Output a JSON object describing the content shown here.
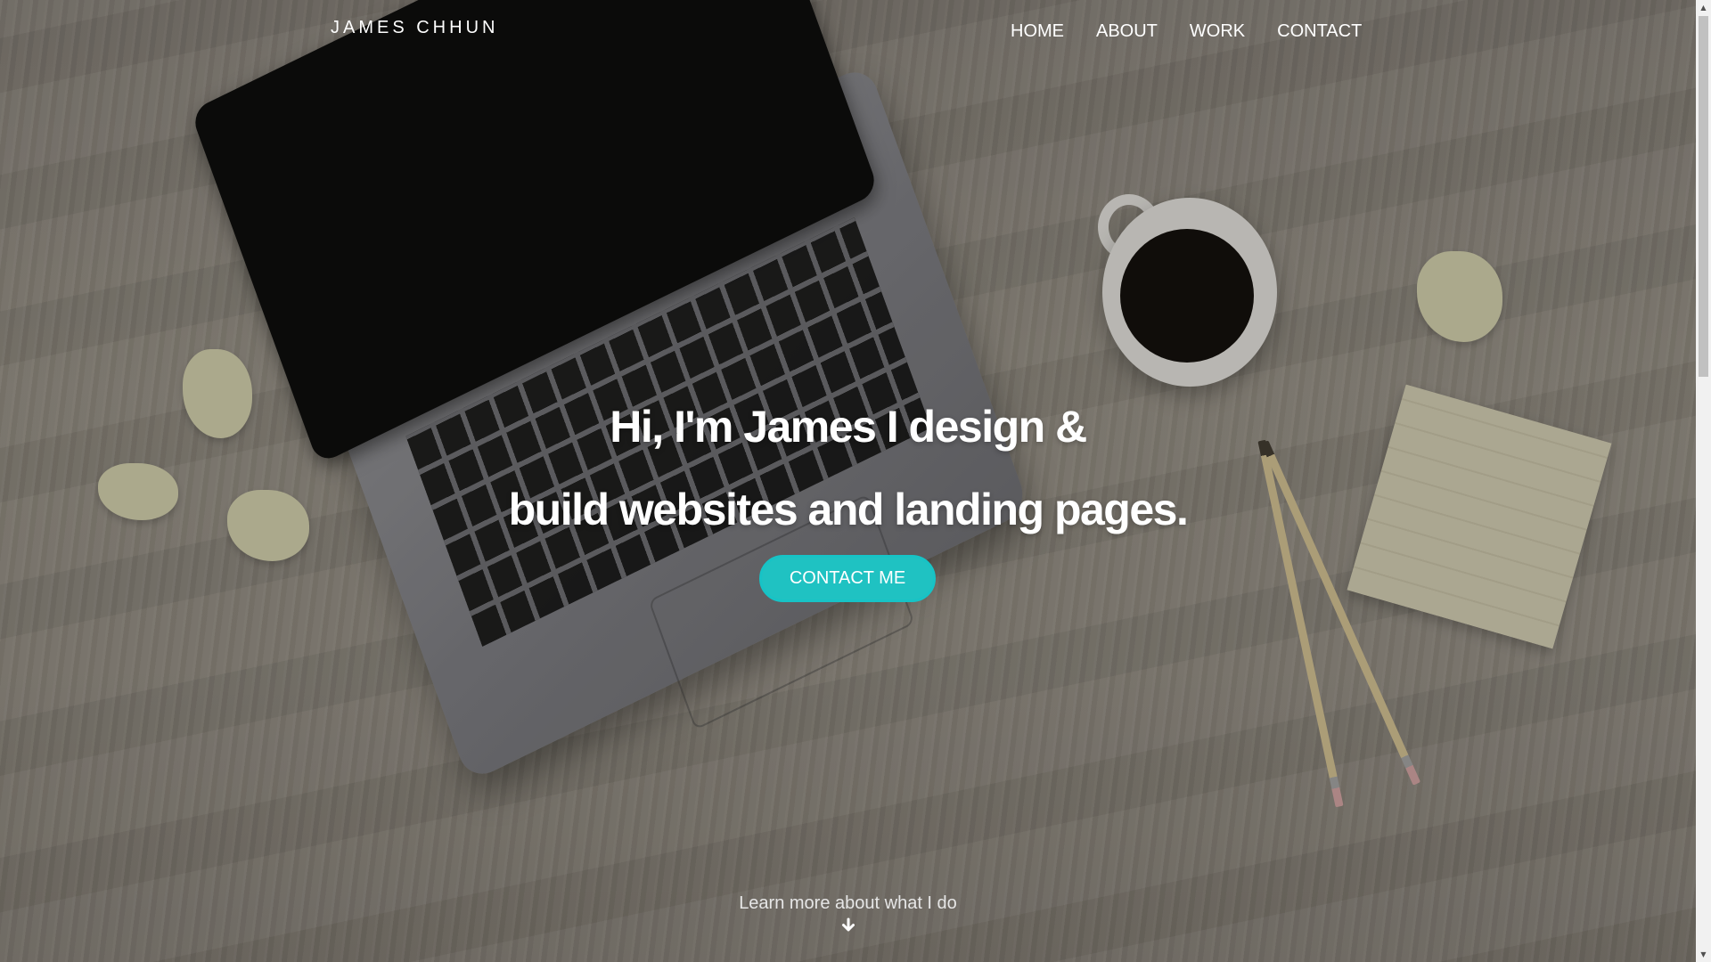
{
  "nav": {
    "brand": "JAMES CHHUN",
    "links": [
      "HOME",
      "ABOUT",
      "WORK",
      "CONTACT"
    ]
  },
  "hero": {
    "headline_line1": "Hi, I'm James I design &",
    "headline_line2": "build websites and landing pages.",
    "cta_label": "CONTACT ME",
    "learn_more": "Learn more about what I do",
    "learn_more_icon": "arrow-down-icon"
  },
  "colors": {
    "accent": "#1fc2c2",
    "text": "#ffffff"
  }
}
